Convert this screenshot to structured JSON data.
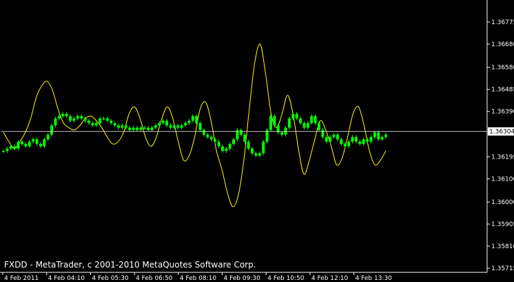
{
  "window": {
    "copyright": "FXDD - MetaTrader, c 2001-2010 MetaQuotes Software Corp."
  },
  "colors": {
    "background": "#000000",
    "candles": "#00ff00",
    "oscillator": "#ffff00",
    "axis": "#ffffff",
    "price_line": "#c0c0c0",
    "current_price_bg": "#ffffff",
    "current_price_text": "#000000"
  },
  "chart_data": {
    "type": "line",
    "x_tick_labels": [
      "4 Feb 2011",
      "4 Feb 04:10",
      "4 Feb 05:30",
      "4 Feb 06:50",
      "4 Feb 08:10",
      "4 Feb 09:30",
      "4 Feb 10:50",
      "4 Feb 12:10",
      "4 Feb 13:30"
    ],
    "y_tick_labels": [
      "1.36775",
      "1.36680",
      "1.36580",
      "1.36485",
      "1.36390",
      "1.36195",
      "1.36100",
      "1.36000",
      "1.35905",
      "1.35810",
      "1.35715"
    ],
    "y_ticks": [
      1.36775,
      1.3668,
      1.3658,
      1.36485,
      1.3639,
      1.36195,
      1.361,
      1.36,
      1.35905,
      1.3581,
      1.35715
    ],
    "ylim": [
      1.35715,
      1.36775
    ],
    "current_price": 1.36304,
    "current_price_label": "1.36304",
    "series": [
      {
        "name": "",
        "type": "candlestick-close",
        "values": [
          1.3622,
          1.3623,
          1.3624,
          1.3623,
          1.3626,
          1.3625,
          1.3624,
          1.3626,
          1.3627,
          1.3625,
          1.3624,
          1.3627,
          1.3629,
          1.3633,
          1.3636,
          1.3637,
          1.3638,
          1.3637,
          1.3635,
          1.3636,
          1.3637,
          1.3636,
          1.3635,
          1.3634,
          1.3633,
          1.3634,
          1.3636,
          1.3636,
          1.3635,
          1.3634,
          1.3633,
          1.3632,
          1.3633,
          1.3632,
          1.3631,
          1.3632,
          1.3631,
          1.3632,
          1.3632,
          1.3631,
          1.3632,
          1.3633,
          1.3634,
          1.3635,
          1.3633,
          1.3632,
          1.3633,
          1.3632,
          1.3633,
          1.3634,
          1.3635,
          1.3637,
          1.3634,
          1.3631,
          1.3629,
          1.3628,
          1.3627,
          1.3626,
          1.3624,
          1.3622,
          1.3623,
          1.3625,
          1.3627,
          1.3631,
          1.3629,
          1.3626,
          1.3623,
          1.3621,
          1.362,
          1.3621,
          1.3626,
          1.3631,
          1.3637,
          1.3633,
          1.363,
          1.3629,
          1.3632,
          1.3636,
          1.3638,
          1.3636,
          1.3634,
          1.3632,
          1.3634,
          1.3637,
          1.3634,
          1.3631,
          1.3628,
          1.3626,
          1.3628,
          1.3629,
          1.3627,
          1.3625,
          1.3624,
          1.3626,
          1.3628,
          1.3626,
          1.3625,
          1.3627,
          1.3626,
          1.3628,
          1.363,
          1.3627,
          1.3628,
          1.3629
        ]
      },
      {
        "name": "",
        "type": "oscillator",
        "values": [
          1.363,
          1.3626,
          1.3623,
          1.3626,
          1.363,
          1.3636,
          1.3645,
          1.365,
          1.3652,
          1.3648,
          1.364,
          1.3634,
          1.3632,
          1.3631,
          1.3633,
          1.3636,
          1.3637,
          1.3635,
          1.3632,
          1.3628,
          1.3625,
          1.3626,
          1.363,
          1.3638,
          1.3641,
          1.3636,
          1.3628,
          1.3624,
          1.3628,
          1.3636,
          1.3641,
          1.3636,
          1.3626,
          1.3618,
          1.362,
          1.3628,
          1.364,
          1.3643,
          1.3635,
          1.3622,
          1.3614,
          1.3604,
          1.3598,
          1.3603,
          1.3618,
          1.364,
          1.366,
          1.3668,
          1.3655,
          1.3638,
          1.3632,
          1.3638,
          1.3646,
          1.3638,
          1.3623,
          1.3612,
          1.3618,
          1.3627,
          1.3635,
          1.3631,
          1.3624,
          1.3616,
          1.3619,
          1.3628,
          1.3638,
          1.3641,
          1.3633,
          1.3622,
          1.3616,
          1.3618,
          1.3622
        ]
      }
    ]
  }
}
